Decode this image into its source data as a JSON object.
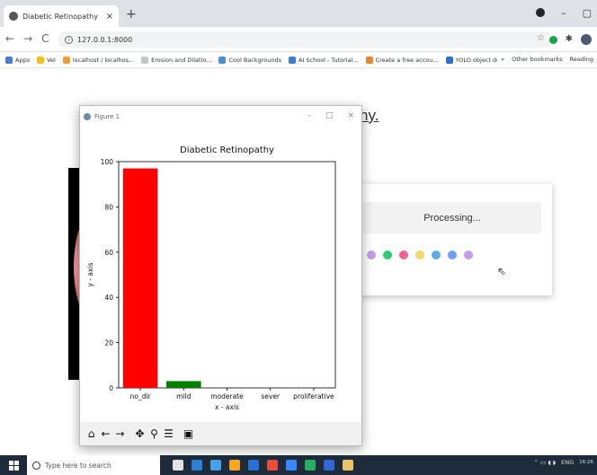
{
  "browser": {
    "tab_title": "Diabetic Retinopathy",
    "tab_close": "×",
    "new_tab": "+",
    "url": "127.0.0.1:8000",
    "nav": {
      "back": "←",
      "forward": "→",
      "reload": "C"
    },
    "bookmarks": [
      {
        "label": "Apps",
        "color": "#4a7bd0"
      },
      {
        "label": "Vel",
        "color": "#f4c20d"
      },
      {
        "label": "localhost / localhos...",
        "color": "#f29d38"
      },
      {
        "label": "Erosion and Dilatio...",
        "color": "#c6c6c6"
      },
      {
        "label": "Cool Backgrounds",
        "color": "#4a90d9"
      },
      {
        "label": "AI School - Tutorial...",
        "color": "#3b7ddd"
      },
      {
        "label": "Create a free accou...",
        "color": "#e7862b"
      },
      {
        "label": "YOLO object detecti...",
        "color": "#2f6fd6"
      }
    ],
    "bookmarks_more": "»",
    "other_bookmarks": "Other bookmarks",
    "reading_list": "Reading"
  },
  "page": {
    "heading": "hy.",
    "processing_text": "Processing...",
    "dot_colors": [
      "#c89be8",
      "#2ecc71",
      "#f06292",
      "#f5d76e",
      "#5dade2",
      "#6c9ef8",
      "#c89be8"
    ]
  },
  "figure": {
    "window_title": "Figure 1",
    "controls": {
      "minimize": "–",
      "maximize": "□",
      "close": "×"
    },
    "toolbar_icons": [
      "home-icon",
      "back-arrow-icon",
      "forward-arrow-icon",
      "pan-icon",
      "zoom-icon",
      "configure-icon",
      "save-icon"
    ]
  },
  "chart_data": {
    "type": "bar",
    "title": "Diabetic Retinopathy",
    "xlabel": "x - axis",
    "ylabel": "y - axis",
    "categories": [
      "no_dir",
      "mild",
      "moderate",
      "sever",
      "proliferative"
    ],
    "values": [
      97,
      3,
      0,
      0,
      0
    ],
    "colors": [
      "#ff0000",
      "#008000",
      "#0000ff",
      "#ffff00",
      "#ff00ff"
    ],
    "ylim": [
      0,
      100
    ],
    "yticks": [
      0,
      20,
      40,
      60,
      80,
      100
    ],
    "grid": false
  },
  "taskbar": {
    "search_placeholder": "Type here to search",
    "app_colors": [
      "#e2e2e2",
      "#2d7fd3",
      "#4aa0e6",
      "#f5a623",
      "#2b6fd0",
      "#e74c3c",
      "#3a86ff",
      "#27ae60",
      "#3367d6",
      "#e9c46a"
    ],
    "tray_lang": "ENG",
    "time": "16:26"
  }
}
